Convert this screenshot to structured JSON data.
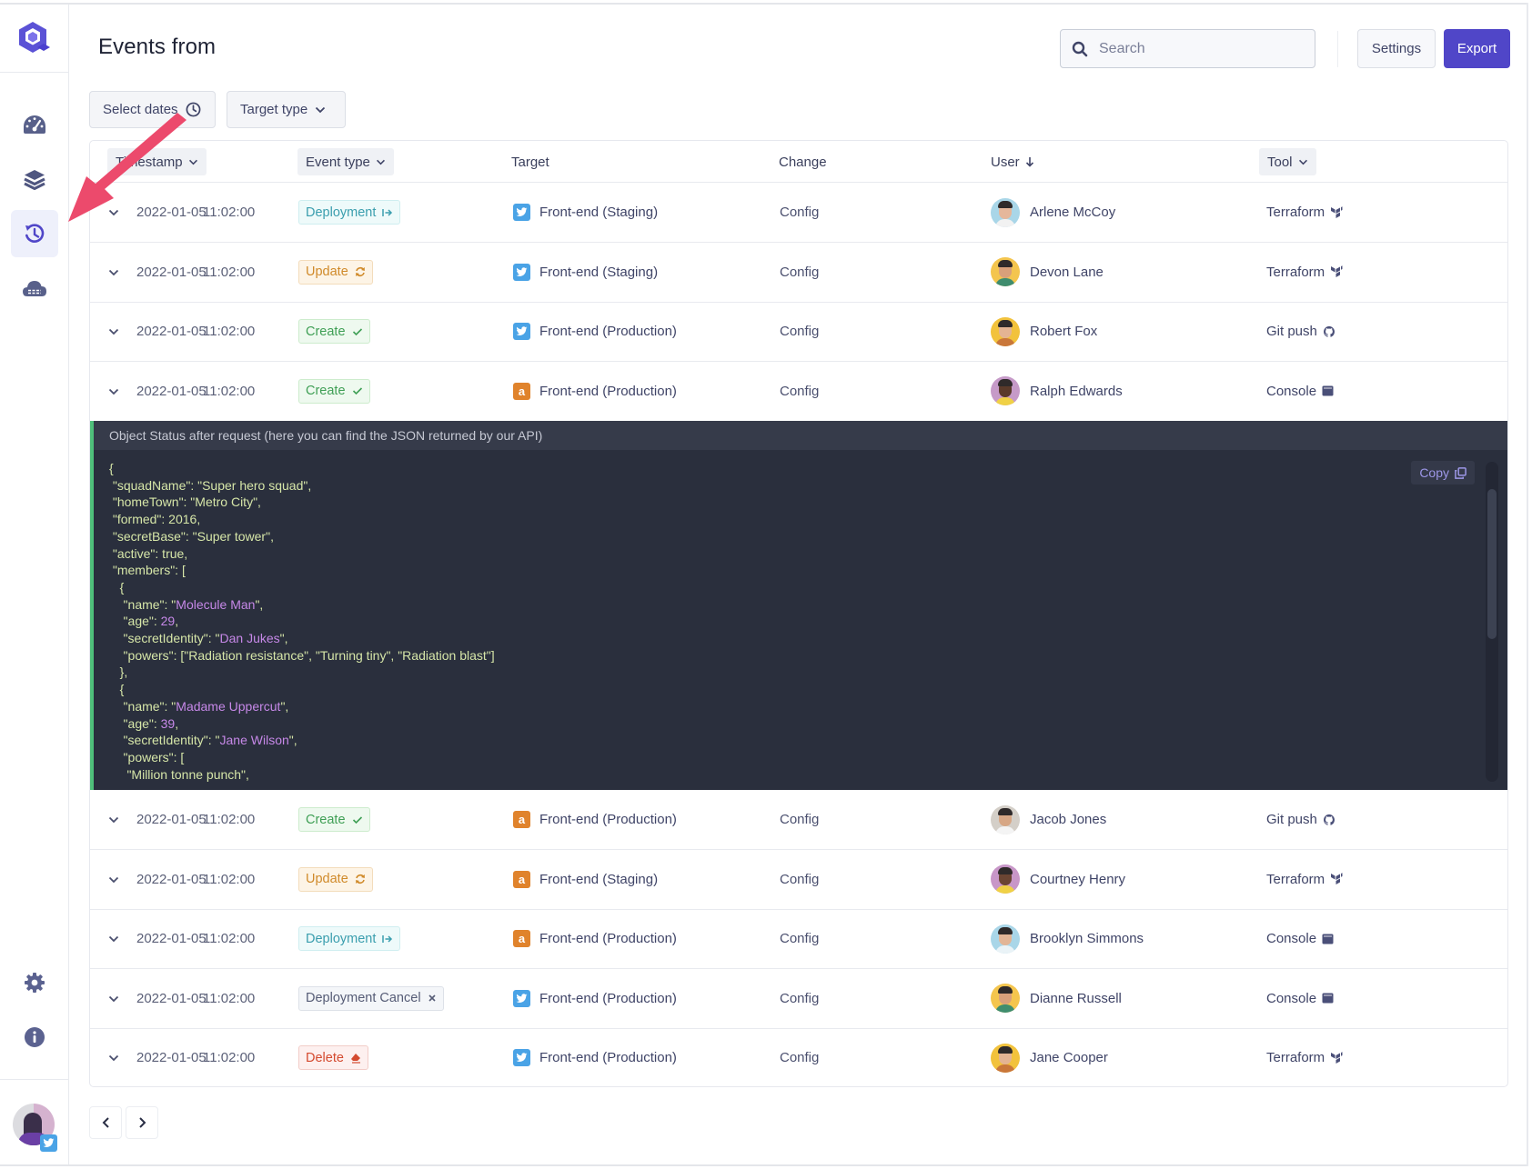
{
  "app": {
    "title": "Events from",
    "search_placeholder": "Search",
    "settings_label": "Settings",
    "export_label": "Export",
    "accent_color": "#5046c8"
  },
  "sidebar": {
    "items": [
      {
        "name": "dashboard",
        "icon": "gauge-icon",
        "active": false
      },
      {
        "name": "layers",
        "icon": "layers-icon",
        "active": false
      },
      {
        "name": "history",
        "icon": "history-icon",
        "active": true
      },
      {
        "name": "cloud",
        "icon": "cloud-icon",
        "active": false
      }
    ],
    "bottom_items": [
      {
        "name": "settings",
        "icon": "gear-icon"
      },
      {
        "name": "info",
        "icon": "info-icon"
      }
    ]
  },
  "filters": {
    "select_dates": "Select dates",
    "target_type": "Target type"
  },
  "table": {
    "columns": {
      "timestamp": "Timestamp",
      "event_type": "Event type",
      "target": "Target",
      "change": "Change",
      "user": "User",
      "tool": "Tool"
    },
    "rows": [
      {
        "date": "2022-01-05",
        "time": "11:02:00",
        "event": "Deployment",
        "event_kind": "deployment",
        "target_icon": "twitter",
        "target": "Front-end (Staging)",
        "change": "Config",
        "user": "Arlene McCoy",
        "tool": "Terraform",
        "tool_icon": "terraform"
      },
      {
        "date": "2022-01-05",
        "time": "11:02:00",
        "event": "Update",
        "event_kind": "update",
        "target_icon": "twitter",
        "target": "Front-end (Staging)",
        "change": "Config",
        "user": "Devon Lane",
        "tool": "Terraform",
        "tool_icon": "terraform"
      },
      {
        "date": "2022-01-05",
        "time": "11:02:00",
        "event": "Create",
        "event_kind": "create",
        "target_icon": "twitter",
        "target": "Front-end (Production)",
        "change": "Config",
        "user": "Robert Fox",
        "tool": "Git push",
        "tool_icon": "github"
      },
      {
        "date": "2022-01-05",
        "time": "11:02:00",
        "event": "Create",
        "event_kind": "create",
        "target_icon": "amazon",
        "target": "Front-end (Production)",
        "change": "Config",
        "user": "Ralph Edwards",
        "tool": "Console",
        "tool_icon": "console",
        "expanded": true
      },
      {
        "date": "2022-01-05",
        "time": "11:02:00",
        "event": "Create",
        "event_kind": "create",
        "target_icon": "amazon",
        "target": "Front-end (Production)",
        "change": "Config",
        "user": "Jacob Jones",
        "tool": "Git push",
        "tool_icon": "github"
      },
      {
        "date": "2022-01-05",
        "time": "11:02:00",
        "event": "Update",
        "event_kind": "update",
        "target_icon": "amazon",
        "target": "Front-end (Staging)",
        "change": "Config",
        "user": "Courtney Henry",
        "tool": "Terraform",
        "tool_icon": "terraform"
      },
      {
        "date": "2022-01-05",
        "time": "11:02:00",
        "event": "Deployment",
        "event_kind": "deployment",
        "target_icon": "amazon",
        "target": "Front-end (Production)",
        "change": "Config",
        "user": "Brooklyn Simmons",
        "tool": "Console",
        "tool_icon": "console"
      },
      {
        "date": "2022-01-05",
        "time": "11:02:00",
        "event": "Deployment Cancel",
        "event_kind": "cancel",
        "target_icon": "twitter",
        "target": "Front-end (Production)",
        "change": "Config",
        "user": "Dianne Russell",
        "tool": "Console",
        "tool_icon": "console"
      },
      {
        "date": "2022-01-05",
        "time": "11:02:00",
        "event": "Delete",
        "event_kind": "delete",
        "target_icon": "twitter",
        "target": "Front-end (Production)",
        "change": "Config",
        "user": "Jane Cooper",
        "tool": "Terraform",
        "tool_icon": "terraform"
      }
    ]
  },
  "expanded": {
    "title": "Object Status after request (here you can find the JSON returned by our API)",
    "copy_label": "Copy",
    "code_lines": [
      [
        {
          "t": "{"
        }
      ],
      [
        {
          "t": " \"squadName\": \"Super hero squad\","
        }
      ],
      [
        {
          "t": " \"homeTown\": \"Metro City\","
        }
      ],
      [
        {
          "t": " \"formed\": 2016,"
        }
      ],
      [
        {
          "t": " \"secretBase\": \"Super tower\","
        }
      ],
      [
        {
          "t": " \"active\": true,"
        }
      ],
      [
        {
          "t": " \"members\": ["
        }
      ],
      [
        {
          "t": "   {"
        }
      ],
      [
        {
          "t": "    \"name\": \""
        },
        {
          "t": "Molecule Man",
          "v": true
        },
        {
          "t": "\","
        }
      ],
      [
        {
          "t": "    \"age\": "
        },
        {
          "t": "29",
          "v": true
        },
        {
          "t": ","
        }
      ],
      [
        {
          "t": "    \"secretIdentity\": \""
        },
        {
          "t": "Dan Jukes",
          "v": true
        },
        {
          "t": "\","
        }
      ],
      [
        {
          "t": "    \"powers\": [\"Radiation resistance\", \"Turning tiny\", \"Radiation blast\"]"
        }
      ],
      [
        {
          "t": "   },"
        }
      ],
      [
        {
          "t": "   {"
        }
      ],
      [
        {
          "t": "    \"name\": \""
        },
        {
          "t": "Madame Uppercut",
          "v": true
        },
        {
          "t": "\","
        }
      ],
      [
        {
          "t": "    \"age\": "
        },
        {
          "t": "39",
          "v": true
        },
        {
          "t": ","
        }
      ],
      [
        {
          "t": "    \"secretIdentity\": \""
        },
        {
          "t": "Jane Wilson",
          "v": true
        },
        {
          "t": "\","
        }
      ],
      [
        {
          "t": "    \"powers\": ["
        }
      ],
      [
        {
          "t": "     \"Million tonne punch\","
        }
      ]
    ]
  },
  "pagination": {
    "prev": "‹",
    "next": "›"
  }
}
